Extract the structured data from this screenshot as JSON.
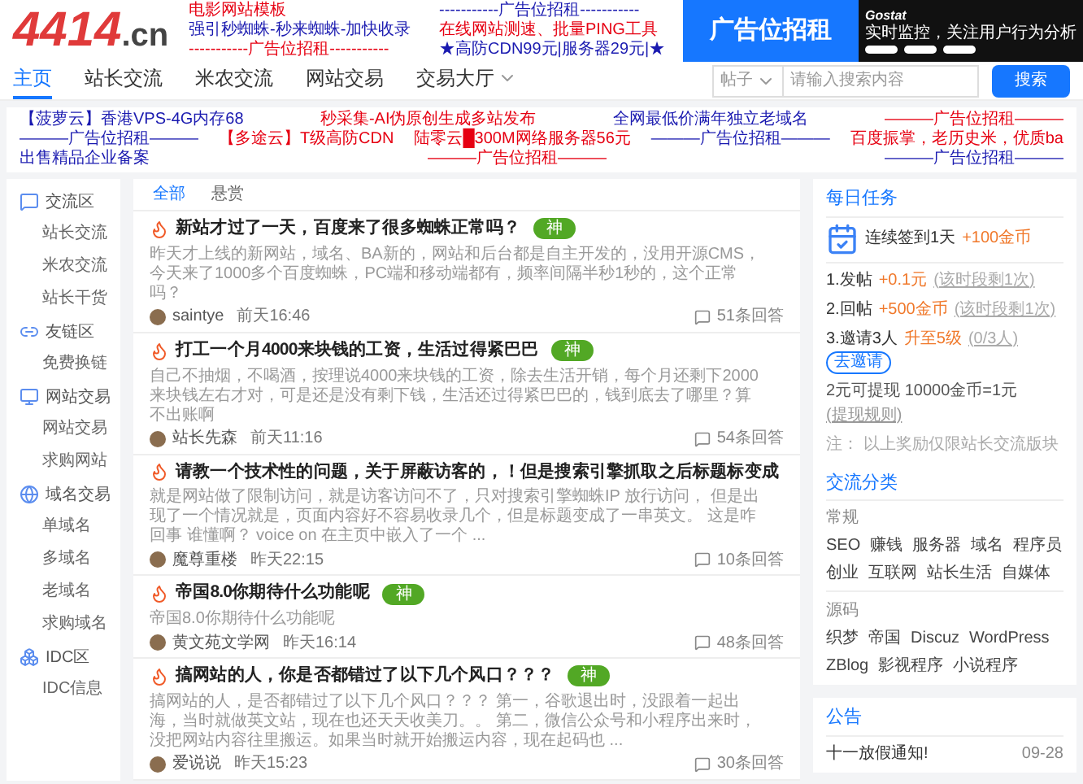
{
  "logo": {
    "text": "4414",
    "suffix": ".cn"
  },
  "text_ads": [
    [
      {
        "text": "电影网站模板",
        "color": "#e60012"
      },
      {
        "text": "强引秒蜘蛛-秒来蜘蛛-加快收录",
        "color": "#1a1ab0"
      },
      {
        "text": "-----------广告位招租-----------",
        "color": "#e60012"
      }
    ],
    [
      {
        "text": "-----------广告位招租-----------",
        "color": "#1a1ab0"
      },
      {
        "text": "在线网站测速、批量PING工具",
        "color": "#e60012"
      },
      {
        "text": "★高防CDN99元|服务器29元|★",
        "color": "#1a1ab0"
      }
    ]
  ],
  "banner_ad": {
    "text": "广告位招租"
  },
  "app_ad": {
    "brand": "Gostat",
    "tagline": "实时监控，关注用户行为分析"
  },
  "nav": {
    "items": [
      {
        "label": "主页",
        "selected": true,
        "has_menu": false
      },
      {
        "label": "站长交流",
        "selected": false,
        "has_menu": false
      },
      {
        "label": "米农交流",
        "selected": false,
        "has_menu": false
      },
      {
        "label": "网站交易",
        "selected": false,
        "has_menu": false
      },
      {
        "label": "交易大厅",
        "selected": false,
        "has_menu": true
      }
    ],
    "search": {
      "scope": "帖子",
      "placeholder": "请输入搜索内容",
      "button": "搜索"
    }
  },
  "link_ads": [
    [
      {
        "text": "【菠萝云】香港VPS-4G内存68",
        "color": "#1a1ab0"
      },
      {
        "text": "秒采集-AI伪原创生成多站发布",
        "color": "#e60012"
      },
      {
        "text": "全网最低价满年独立老域名",
        "color": "#1a1ab0"
      },
      {
        "text": "———广告位招租———",
        "color": "#e60012"
      },
      {
        "text": "———广告位招租———",
        "color": "#1a1ab0"
      },
      {
        "text": "【多途云】T级高防CDN",
        "color": "#e60012"
      }
    ],
    [
      {
        "text": "陆零云█300M网络服务器56元",
        "color": "#e60012"
      },
      {
        "text": "———广告位招租———",
        "color": "#1a1ab0"
      },
      {
        "text": "百度振掌，老历史米，优质ba",
        "color": "#e60012"
      },
      {
        "text": "出售精品企业备案",
        "color": "#1a1ab0"
      },
      {
        "text": "———广告位招租———",
        "color": "#e60012"
      },
      {
        "text": "———广告位招租———",
        "color": "#1a1ab0"
      }
    ]
  ],
  "sidebar": {
    "sections": [
      {
        "label": "交流区",
        "kind": "chat",
        "children": [
          {
            "label": "站长交流"
          },
          {
            "label": "米农交流"
          },
          {
            "label": "站长干货"
          }
        ]
      },
      {
        "label": "友链区",
        "kind": "link",
        "children": [
          {
            "label": "免费换链"
          }
        ]
      },
      {
        "label": "网站交易",
        "kind": "monitor",
        "children": [
          {
            "label": "网站交易"
          },
          {
            "label": "求购网站"
          }
        ]
      },
      {
        "label": "域名交易",
        "kind": "globe",
        "children": [
          {
            "label": "单域名"
          },
          {
            "label": "多域名"
          },
          {
            "label": "老域名"
          },
          {
            "label": "求购域名"
          }
        ]
      },
      {
        "label": "IDC区",
        "kind": "server",
        "children": [
          {
            "label": "IDC信息"
          }
        ]
      }
    ]
  },
  "feed": {
    "tabs": [
      {
        "label": "全部",
        "selected": true
      },
      {
        "label": "悬赏",
        "selected": false
      }
    ],
    "posts": [
      {
        "title": "新站才过了一天，百度来了很多蜘蛛正常吗？",
        "badge": "神",
        "excerpt": "昨天才上线的新网站，域名、BA新的，网站和后台都是自主开发的，没用开源CMS，今天来了1000多个百度蜘蛛，PC端和移动端都有，频率间隔半秒1秒的，这个正常吗？",
        "author": "saintye",
        "time": "前天16:46",
        "replies": "51条回答"
      },
      {
        "title": "打工一个月4000来块钱的工资，生活过得紧巴巴",
        "badge": "神",
        "excerpt": "自己不抽烟，不喝酒，按理说4000来块钱的工资，除去生活开销，每个月还剩下2000来块钱左右才对，可是还是没有剩下钱，生活还过得紧巴巴的，钱到底去了哪里？算不出账啊",
        "author": "站长先森",
        "time": "前天11:16",
        "replies": "54条回答"
      },
      {
        "title": "请教一个技术性的问题，关于屏蔽访客的，！但是搜索引擎抓取之后标题标变成",
        "excerpt": "就是网站做了限制访问，就是访客访问不了，只对搜索引擎蜘蛛IP 放行访问， 但是出现了一个情况就是，页面内容好不容易收录几个，但是标题变成了一串英文。 这是咋回事 谁懂啊？ voice on 在主页中嵌入了一个 ...",
        "author": "魔尊重楼",
        "time": "昨天22:15",
        "replies": "10条回答"
      },
      {
        "title": "帝国8.0你期待什么功能呢",
        "badge": "神",
        "excerpt": "帝国8.0你期待什么功能呢",
        "author": "黄文苑文学网",
        "time": "昨天16:14",
        "replies": "48条回答"
      },
      {
        "title": "搞网站的人，你是否都错过了以下几个风口？？？",
        "badge": "神",
        "excerpt": "搞网站的人，是否都错过了以下几个风口？？？ 第一，谷歌退出时，没跟着一起出海，当时就做英文站，现在也还天天收美刀。。 第二，微信公众号和小程序出来时，没把网站内容往里搬运。如果当时就开始搬运内容，现在起码也 ...",
        "author": "爱说说",
        "time": "昨天15:23",
        "replies": "30条回答"
      }
    ]
  },
  "daily_tasks": {
    "title": "每日任务",
    "checkin": "连续签到1天",
    "checkin_reward": "+100金币",
    "tasks": [
      {
        "label": "1.发帖",
        "reward": "+0.1元",
        "note": "(该时段剩1次)"
      },
      {
        "label": "2.回帖",
        "reward": "+500金币",
        "note": "(该时段剩1次)"
      },
      {
        "label": "3.邀请3人",
        "reward": "升至5级",
        "note": "(0/3人)",
        "button": "去邀请"
      }
    ],
    "exchange": "2元可提现 10000金币=1元",
    "exchange_link": "(提现规则)",
    "footnote": "注：  以上奖励仅限站长交流版块"
  },
  "categories": {
    "title": "交流分类",
    "groups": [
      {
        "name": "常规",
        "tags": [
          "SEO",
          "赚钱",
          "服务器",
          "域名",
          "程序员",
          "创业",
          "互联网",
          "站长生活",
          "自媒体"
        ]
      },
      {
        "name": "源码",
        "tags": [
          "织梦",
          "帝国",
          "Discuz",
          "WordPress",
          "ZBlog",
          "影视程序",
          "小说程序"
        ]
      }
    ]
  },
  "notice": {
    "title": "公告",
    "items": [
      {
        "text": "十一放假通知!",
        "date": "09-28"
      }
    ]
  }
}
